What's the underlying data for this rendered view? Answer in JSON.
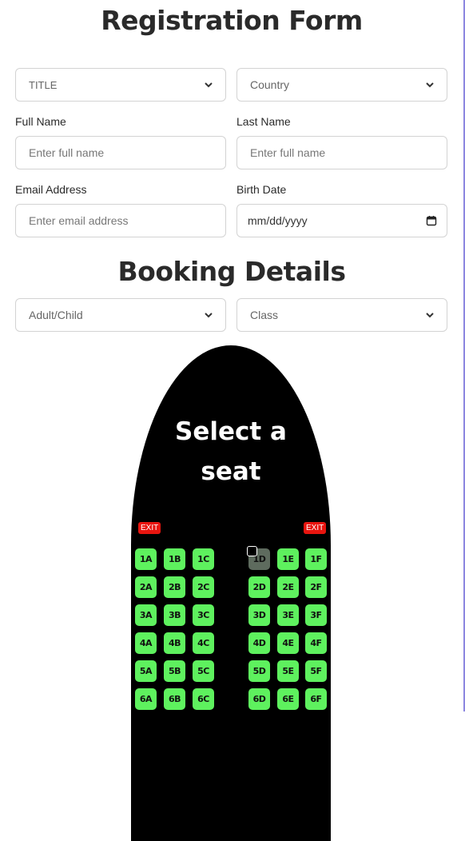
{
  "registration": {
    "title": "Registration Form",
    "title_select": "TITLE",
    "country_select": "Country",
    "full_name_label": "Full Name",
    "full_name_placeholder": "Enter full name",
    "last_name_label": "Last Name",
    "last_name_placeholder": "Enter full name",
    "email_label": "Email Address",
    "email_placeholder": "Enter email address",
    "birth_label": "Birth Date",
    "birth_value": "mm/dd/yyyy"
  },
  "booking": {
    "title": "Booking Details",
    "passenger_select": "Adult/Child",
    "class_select": "Class"
  },
  "seat_map": {
    "title_line1": "Select a",
    "title_line2": "seat",
    "exit_left": "EXIT",
    "exit_right": "EXIT",
    "rows": [
      [
        "1A",
        "1B",
        "1C",
        "1D",
        "1E",
        "1F"
      ],
      [
        "2A",
        "2B",
        "2C",
        "2D",
        "2E",
        "2F"
      ],
      [
        "3A",
        "3B",
        "3C",
        "3D",
        "3E",
        "3F"
      ],
      [
        "4A",
        "4B",
        "4C",
        "4D",
        "4E",
        "4F"
      ],
      [
        "5A",
        "5B",
        "5C",
        "5D",
        "5E",
        "5F"
      ],
      [
        "6A",
        "6B",
        "6C",
        "6D",
        "6E",
        "6F"
      ]
    ],
    "occupied": [
      "1D"
    ],
    "colors": {
      "available": "#5ef15e",
      "occupied": "#5e6b5e",
      "exit": "#e8150f",
      "plane": "#000000"
    }
  }
}
